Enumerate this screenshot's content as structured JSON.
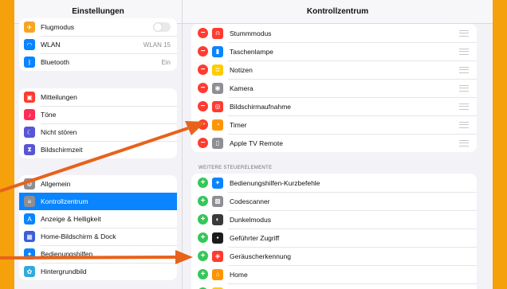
{
  "left": {
    "title": "Einstellungen",
    "group1": [
      {
        "label": "Flugmodus",
        "value": "",
        "icon": "airplane-icon",
        "color": "#f5a623",
        "toggle": true
      },
      {
        "label": "WLAN",
        "value": "WLAN 15",
        "icon": "wifi-icon",
        "color": "#0a84ff"
      },
      {
        "label": "Bluetooth",
        "value": "Ein",
        "icon": "bluetooth-icon",
        "color": "#0a84ff"
      }
    ],
    "group2": [
      {
        "label": "Mitteilungen",
        "icon": "notifications-icon",
        "color": "#ff3b30"
      },
      {
        "label": "Töne",
        "icon": "sounds-icon",
        "color": "#ff2d55"
      },
      {
        "label": "Nicht stören",
        "icon": "moon-icon",
        "color": "#5856d6"
      },
      {
        "label": "Bildschirmzeit",
        "icon": "hourglass-icon",
        "color": "#5856d6"
      }
    ],
    "group3": [
      {
        "label": "Allgemein",
        "icon": "gear-icon",
        "color": "#8e8e93"
      },
      {
        "label": "Kontrollzentrum",
        "icon": "toggles-icon",
        "color": "#8e8e93",
        "selected": true
      },
      {
        "label": "Anzeige & Helligkeit",
        "icon": "text-size-icon",
        "color": "#0a84ff"
      },
      {
        "label": "Home-Bildschirm & Dock",
        "icon": "grid-icon",
        "color": "#3b5fd9"
      },
      {
        "label": "Bedienungshilfen",
        "icon": "accessibility-icon",
        "color": "#0a84ff"
      },
      {
        "label": "Hintergrundbild",
        "icon": "flower-icon",
        "color": "#34aadc"
      }
    ]
  },
  "right": {
    "title": "Kontrollzentrum",
    "included": [
      {
        "label": "Stummmodus",
        "icon": "bell-icon",
        "color": "#ff3b30"
      },
      {
        "label": "Taschenlampe",
        "icon": "flashlight-icon",
        "color": "#0a84ff"
      },
      {
        "label": "Notizen",
        "icon": "notes-icon",
        "color": "#ffcc00"
      },
      {
        "label": "Kamera",
        "icon": "camera-icon",
        "color": "#8e8e93"
      },
      {
        "label": "Bildschirmaufnahme",
        "icon": "record-icon",
        "color": "#ff3b30"
      },
      {
        "label": "Timer",
        "icon": "timer-icon",
        "color": "#ff9500"
      },
      {
        "label": "Apple TV Remote",
        "icon": "remote-icon",
        "color": "#8e8e93"
      }
    ],
    "section_header": "WEITERE STEUERELEMENTE",
    "more": [
      {
        "label": "Bedienungshilfen-Kurzbefehle",
        "icon": "accessibility-icon",
        "color": "#0a84ff"
      },
      {
        "label": "Codescanner",
        "icon": "qr-icon",
        "color": "#8e8e93"
      },
      {
        "label": "Dunkelmodus",
        "icon": "dark-mode-icon",
        "color": "#3a3a3c"
      },
      {
        "label": "Geführter Zugriff",
        "icon": "lock-icon",
        "color": "#1c1c1e"
      },
      {
        "label": "Geräuscherkennung",
        "icon": "sound-recognition-icon",
        "color": "#ff3b30"
      },
      {
        "label": "Home",
        "icon": "home-icon",
        "color": "#ff9500"
      },
      {
        "label": "",
        "icon": "partial-icon",
        "color": "#ffcc00"
      }
    ]
  },
  "arrow_color": "#e8621a"
}
